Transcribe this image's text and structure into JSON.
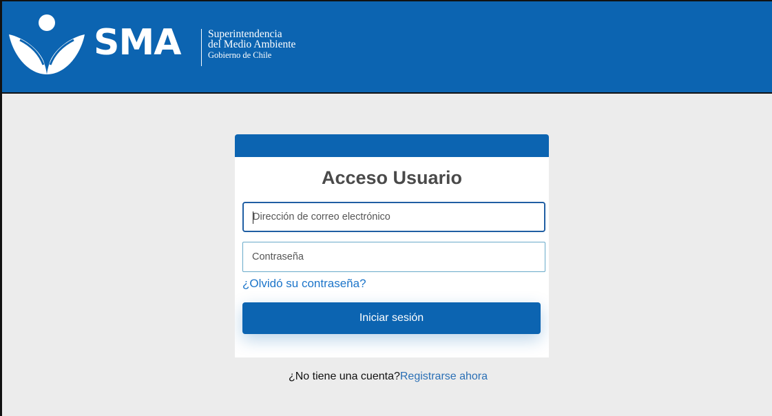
{
  "header": {
    "brand": "SMA",
    "subtitle_line1": "Superintendencia",
    "subtitle_line2": "del Medio Ambiente",
    "subtitle_line3": "Gobierno de Chile"
  },
  "login": {
    "title": "Acceso Usuario",
    "email_placeholder": "Dirección de correo electrónico",
    "email_value": "",
    "password_placeholder": "Contraseña",
    "password_value": "",
    "forgot_label": "¿Olvidó su contraseña?",
    "submit_label": "Iniciar sesión"
  },
  "signup": {
    "prompt": "¿No tiene una cuenta?",
    "link_label": "Registrarse ahora"
  },
  "colors": {
    "brand_blue": "#0c64b1",
    "link_blue": "#1b74c9",
    "background": "#ececec"
  },
  "icons": {
    "logo": "sma-leaf-figure-icon"
  }
}
